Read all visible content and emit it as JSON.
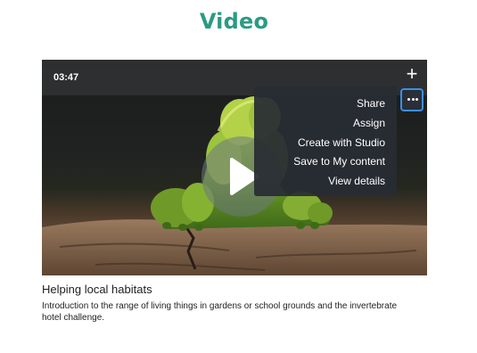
{
  "page": {
    "title": "Video"
  },
  "video_card": {
    "duration": "03:47",
    "add_icon": "plus-icon",
    "more_icon": "ellipsis-icon",
    "play_icon": "play-icon",
    "title": "Helping local habitats",
    "description": "Introduction to the range of living things in gardens or school grounds and the invertebrate hotel challenge."
  },
  "menu": {
    "items": [
      {
        "label": "Share"
      },
      {
        "label": "Assign"
      },
      {
        "label": "Create with Studio"
      },
      {
        "label": "Save to My content"
      },
      {
        "label": "View details"
      }
    ]
  },
  "colors": {
    "title_accent": "#2b9a84",
    "focus_ring": "#3a8ee6",
    "menu_bg": "#282c34"
  }
}
